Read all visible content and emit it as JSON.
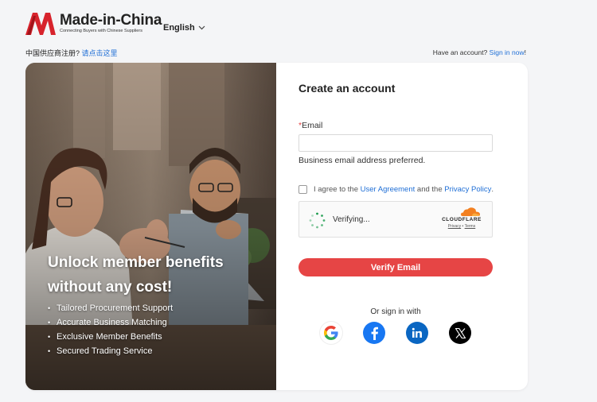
{
  "header": {
    "logo_name": "Made-in-China",
    "logo_tagline": "Connecting Buyers with Chinese Suppliers",
    "language": "English",
    "supplier_prompt": "中国供应商注册?",
    "supplier_link": "请点击这里",
    "account_prompt": "Have an account?",
    "signin_link": "Sign in now",
    "signin_suffix": "!"
  },
  "hero": {
    "title_line1": "Unlock member benefits",
    "title_line2": "without any cost!",
    "benefits": [
      "Tailored Procurement Support",
      "Accurate Business Matching",
      "Exclusive Member Benefits",
      "Secured Trading Service"
    ]
  },
  "form": {
    "title": "Create an account",
    "email_required_mark": "*",
    "email_label": "Email",
    "email_value": "",
    "email_placeholder": "",
    "email_hint": "Business email address preferred.",
    "agree_prefix": "I agree to the ",
    "user_agreement": "User Agreement",
    "agree_middle": " and the ",
    "privacy_policy": "Privacy Policy",
    "agree_suffix": ".",
    "captcha_status": "Verifying...",
    "captcha_brand": "CLOUDFLARE",
    "captcha_privacy": "Privacy",
    "captcha_sep": " • ",
    "captcha_terms": "Terms",
    "verify_button": "Verify Email",
    "or_sign_in": "Or sign in with",
    "social": [
      "google-icon",
      "facebook-icon",
      "linkedin-icon",
      "x-icon"
    ]
  },
  "colors": {
    "accent_red": "#e64545",
    "link_blue": "#1f6fd6",
    "facebook": "#1877f2",
    "linkedin": "#0a66c2"
  }
}
